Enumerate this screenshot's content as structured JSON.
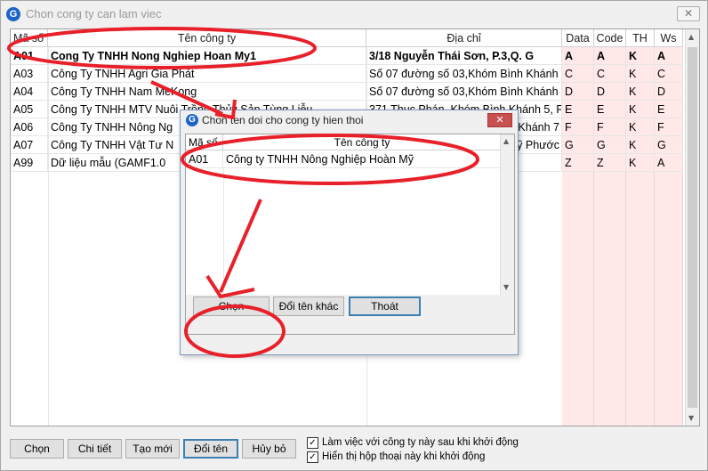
{
  "window": {
    "title": "Chon cong ty can lam viec",
    "logo_letter": "G",
    "close_glyph": "✕"
  },
  "grid": {
    "columns": [
      "Mã số",
      "Tên công ty",
      "Địa chỉ",
      "Data",
      "Code",
      "TH",
      "Ws"
    ],
    "rows": [
      [
        "A01",
        "Cong Ty TNHH Nong Nghiep Hoan My1",
        "3/18 Nguyễn Thái Sơn, P.3,Q. G",
        "A",
        "A",
        "K",
        "A"
      ],
      [
        "A03",
        "Công Ty TNHH Agri Gia Phát",
        "Số 07 đường số 03,Khóm Bình Khánh",
        "C",
        "C",
        "K",
        "C"
      ],
      [
        "A04",
        "Công Ty TNHH Nam MeKong",
        "Số 07 đường số 03,Khóm Bình Khánh",
        "D",
        "D",
        "K",
        "D"
      ],
      [
        "A05",
        "Công Ty TNHH MTV Nuôi Trồng Thủy Sản Tùng Liễu",
        "371 Thục Phán, Khóm Bình Khánh 5, F",
        "E",
        "E",
        "K",
        "E"
      ],
      [
        "A06",
        "Công Ty TNHH Nông Ng",
        "Khánh 7",
        "F",
        "F",
        "K",
        "F"
      ],
      [
        "A07",
        "Công Ty TNHH Vật Tư N",
        "Mỹ Phước",
        "G",
        "G",
        "K",
        "G"
      ],
      [
        "A99",
        "Dữ liệu mẫu (GAMF1.0",
        "",
        "Z",
        "Z",
        "K",
        "A"
      ]
    ]
  },
  "buttons": {
    "chon": "Chọn",
    "chi_tiet": "Chi tiết",
    "tao_moi": "Tạo mới",
    "doi_ten": "Đổi tên",
    "huy_bo": "Hủy bỏ"
  },
  "checkboxes": {
    "work_with_company": "Làm việc với công ty này sau khi khởi động",
    "show_dialog": "Hiển thị hộp thoại này khi khởi động",
    "check_glyph": "✓"
  },
  "dialog": {
    "title": "Chon ten doi cho cong ty hien thoi",
    "logo_letter": "G",
    "close_glyph": "✕",
    "columns": [
      "Mã số",
      "Tên công ty"
    ],
    "rows": [
      [
        "A01",
        "Công ty TNHH Nông Nghiệp Hoàn Mỹ"
      ]
    ],
    "buttons": {
      "chon": "Chọn",
      "doi_ten_khac": "Đổi tên khác",
      "thoat": "Thoát"
    }
  },
  "scroll_arrows": {
    "up": "▲",
    "down": "▼"
  },
  "colors": {
    "annotation": "#e8202a",
    "data_columns_bg": "#ffe8e8",
    "default_button_border": "#3c7fb1",
    "logo": "#1e64c8"
  }
}
